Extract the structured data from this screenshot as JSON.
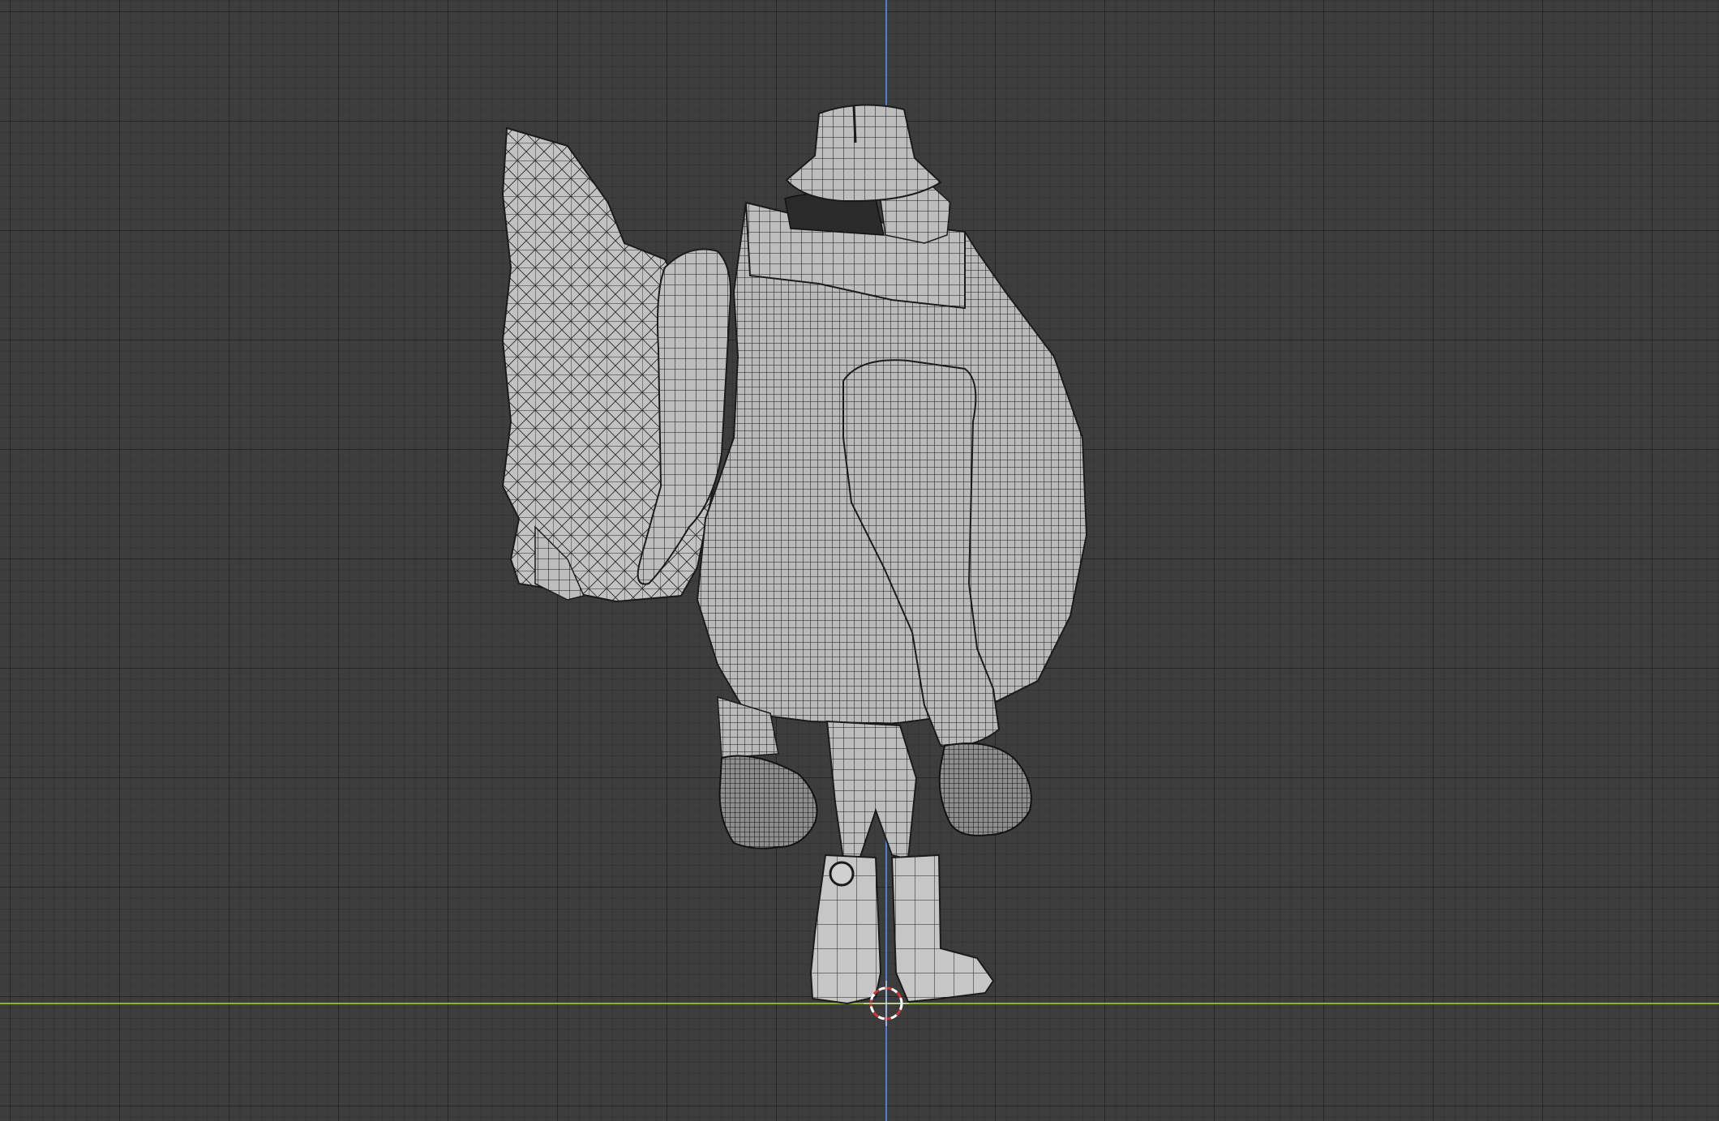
{
  "viewport": {
    "mode": "orthographic-right-view",
    "shading": "wireframe-over-solid",
    "colors": {
      "background": "#3d3d3d",
      "grid_major": "#2f2f2f",
      "grid_minor": "#373737",
      "axis_z": "#4a7fd6",
      "axis_y": "#8ab234",
      "mesh_fill": "#b9b9b9",
      "mesh_wire": "#1c1c1c",
      "cursor_red": "#c43a3a",
      "cursor_white": "#ffffff"
    }
  },
  "scene": {
    "object": "character-model-side-view",
    "parts": [
      "hat",
      "coat",
      "collar",
      "sleeve",
      "left-hand",
      "right-hand",
      "legs",
      "boots",
      "backpack-bundle"
    ]
  },
  "icons": {
    "cursor": "3d-cursor-icon"
  }
}
